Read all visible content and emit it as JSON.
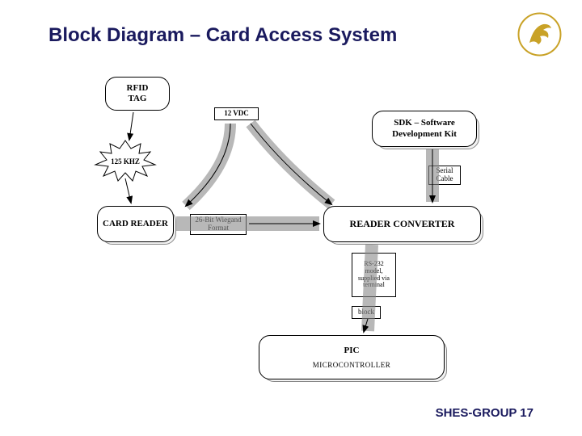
{
  "title": "Block Diagram – Card Access System",
  "footer": "SHES-GROUP 17",
  "blocks": {
    "rfid": "RFID\nTAG",
    "sdk": "SDK – Software Development Kit",
    "cardReader": "CARD READER",
    "converter": "READER CONVERTER",
    "pic1": "PIC",
    "pic2": "MICROCONTROLLER"
  },
  "labels": {
    "vdc": "12 VDC",
    "khz": "125 KHZ",
    "wiegand": "26-Bit Wiegand Format",
    "serial": "Serial Cable",
    "rs232": "RS-232 model, supplied via terminal",
    "block": "block"
  }
}
